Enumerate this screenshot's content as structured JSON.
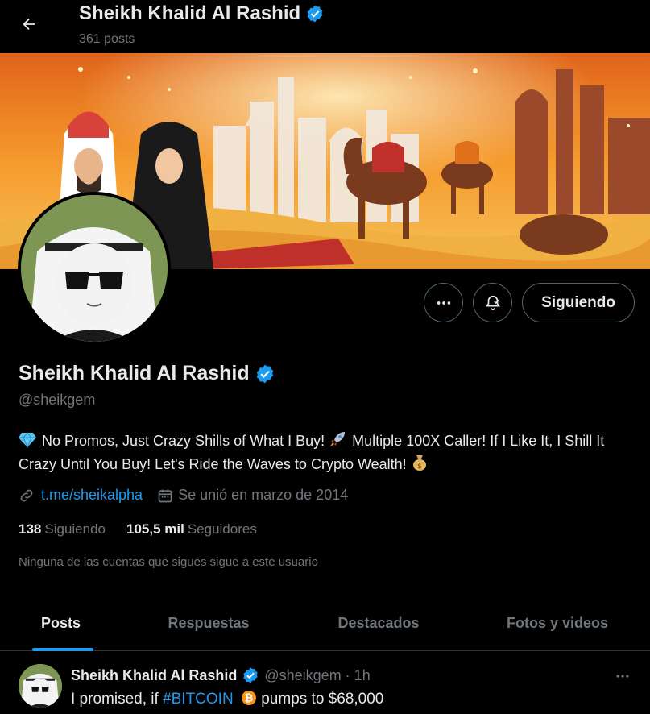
{
  "header": {
    "title": "Sheikh Khalid Al Rashid",
    "posts_count": "361 posts"
  },
  "profile": {
    "name": "Sheikh Khalid Al Rashid",
    "handle": "@sheikgem",
    "bio_parts": [
      "No Promos, Just Crazy Shills of What I Buy!",
      "Multiple 100X Caller! If I Like It, I Shill It Crazy Until You Buy! Let's Ride the Waves to Crypto Wealth!"
    ],
    "link": "t.me/sheikalpha",
    "joined": "Se unió en marzo de 2014",
    "following_count": "138",
    "following_label": "Siguiendo",
    "followers_count": "105,5 mil",
    "followers_label": "Seguidores",
    "mutual_note": "Ninguna de las cuentas que sigues sigue a este usuario"
  },
  "actions": {
    "follow_label": "Siguiendo"
  },
  "tabs": [
    {
      "label": "Posts",
      "active": true
    },
    {
      "label": "Respuestas",
      "active": false
    },
    {
      "label": "Destacados",
      "active": false
    },
    {
      "label": "Fotos y videos",
      "active": false
    }
  ],
  "post": {
    "name": "Sheikh Khalid Al Rashid",
    "handle_time": "@sheikgem · 1h",
    "text_before": "I promised, if ",
    "hashtag": "#BITCOIN",
    "text_after": " pumps to $68,000"
  },
  "colors": {
    "accent": "#1d9bf0",
    "background": "#000000",
    "muted": "#71767b",
    "text": "#e7e9ea",
    "verified": "#1d9bf0"
  }
}
